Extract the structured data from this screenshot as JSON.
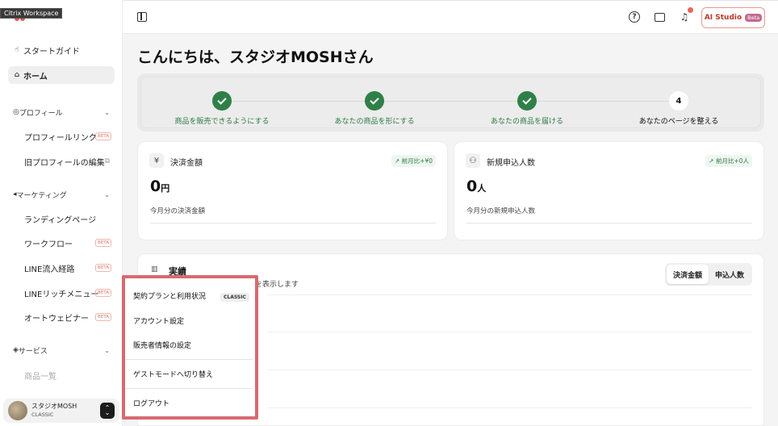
{
  "tooltip": "Citrix Workspace",
  "sidebar": {
    "start_guide": "スタートガイド",
    "home": "ホーム",
    "profile_section": "プロフィール",
    "profile_link": "プロフィールリンク",
    "old_profile": "旧プロフィールの編集",
    "marketing_section": "マーケティング",
    "landing": "ランディングページ",
    "workflow": "ワークフロー",
    "line_route": "LINE流入経路",
    "line_rich": "LINEリッチメニュー",
    "webinar": "オートウェビナー",
    "service_section": "サービス",
    "products": "商品一覧",
    "beta": "BETA"
  },
  "account": {
    "name": "スタジオMOSH",
    "plan": "CLASSIC"
  },
  "topbar": {
    "ai_label": "AI Studio",
    "ai_beta": "Beta"
  },
  "greeting": "こんにちは、スタジオMOSHさん",
  "steps": [
    {
      "label": "商品を販売できるようにする",
      "status": "done"
    },
    {
      "label": "あなたの商品を形にする",
      "status": "done"
    },
    {
      "label": "あなたの商品を届ける",
      "status": "done"
    },
    {
      "label": "あなたのページを整える",
      "status": "current",
      "number": "4"
    }
  ],
  "cards": {
    "payment": {
      "icon": "¥",
      "title": "決済金額",
      "trend": "前月比+¥0",
      "value": "0",
      "unit": "円",
      "sub": "今月分の決済金額"
    },
    "signups": {
      "title": "新規申込人数",
      "trend": "前月比+0人",
      "value": "0",
      "unit": "人",
      "sub": "今月分の新規申込人数"
    }
  },
  "performance": {
    "title": "実績",
    "desc": "を表示します",
    "toggle": [
      "決済金額",
      "申込人数"
    ]
  },
  "popup": {
    "plan": "契約プランと利用状況",
    "plan_badge": "CLASSIC",
    "account_settings": "アカウント設定",
    "seller_info": "販売者情報の設定",
    "guest_mode": "ゲストモードへ切り替え",
    "logout": "ログアウト"
  },
  "colors": {
    "accent_green": "#2f8048",
    "beta_red": "#e0736a",
    "highlight": "#d86a6f"
  }
}
